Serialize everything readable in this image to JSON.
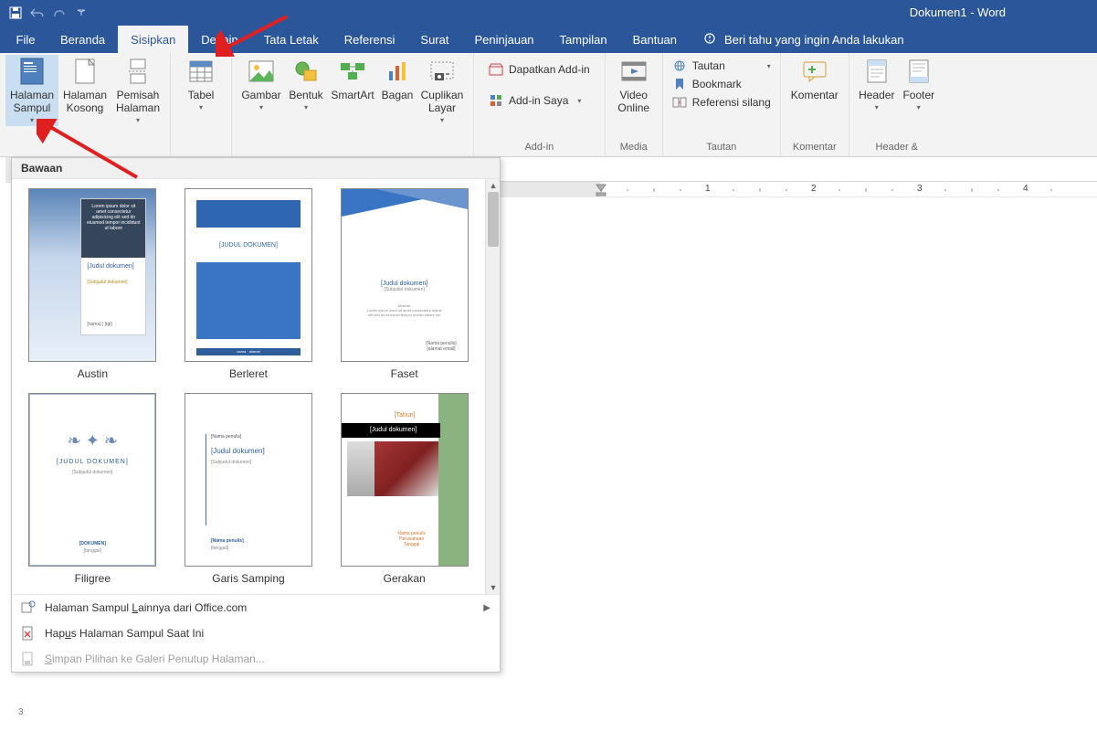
{
  "title": "Dokumen1  -  Word",
  "tabs": {
    "file": "File",
    "home": "Beranda",
    "insert": "Sisipkan",
    "design": "Desain",
    "layout": "Tata Letak",
    "references": "Referensi",
    "mailings": "Surat",
    "review": "Peninjauan",
    "view": "Tampilan",
    "help": "Bantuan",
    "tellme": "Beri tahu yang ingin Anda lakukan"
  },
  "ribbon": {
    "pages": {
      "cover": "Halaman Sampul",
      "blank": "Halaman Kosong",
      "break": "Pemisah Halaman"
    },
    "tables": {
      "table": "Tabel"
    },
    "illustrations": {
      "picture": "Gambar",
      "shapes": "Bentuk",
      "smartart": "SmartArt",
      "chart": "Bagan",
      "screenshot": "Cuplikan Layar"
    },
    "addins": {
      "get": "Dapatkan Add-in",
      "my": "Add-in Saya",
      "group": "Add-in"
    },
    "media": {
      "video": "Video Online",
      "group": "Media"
    },
    "links": {
      "hyperlink": "Tautan",
      "bookmark": "Bookmark",
      "crossref": "Referensi silang",
      "group": "Tautan"
    },
    "comments": {
      "comment": "Komentar",
      "group": "Komentar"
    },
    "headerfooter": {
      "header": "Header",
      "footer": "Footer",
      "group": "Header &"
    }
  },
  "gallery": {
    "head": "Bawaan",
    "items": [
      {
        "name": "Austin",
        "title": "[Judul dokumen]",
        "sub": "[Subjudul dokumen]"
      },
      {
        "name": "Berleret",
        "title": "[JUDUL DOKUMEN]"
      },
      {
        "name": "Faset",
        "title": "[Judul dokumen]",
        "sub": "[Subjudul dokumen]"
      },
      {
        "name": "Filigree",
        "title": "[JUDUL DOKUMEN]",
        "sub": "[Subjudul dokumen]"
      },
      {
        "name": "Garis Samping",
        "title": "[Judul dokumen]",
        "sub": "[Subjudul dokumen]"
      },
      {
        "name": "Gerakan",
        "year": "[Tahun]",
        "title": "[Judul dokumen]"
      }
    ],
    "more_pre": "Halaman Sampul ",
    "more_u": "L",
    "more_post": "ainnya dari Office.com",
    "remove_pre": "Hap",
    "remove_u": "u",
    "remove_post": "s Halaman Sampul Saat Ini",
    "save_pre": "",
    "save_u": "S",
    "save_post": "impan Pilihan ke Galeri Penutup Halaman..."
  },
  "ruler_nums": [
    "1",
    "2",
    "3",
    "4"
  ]
}
